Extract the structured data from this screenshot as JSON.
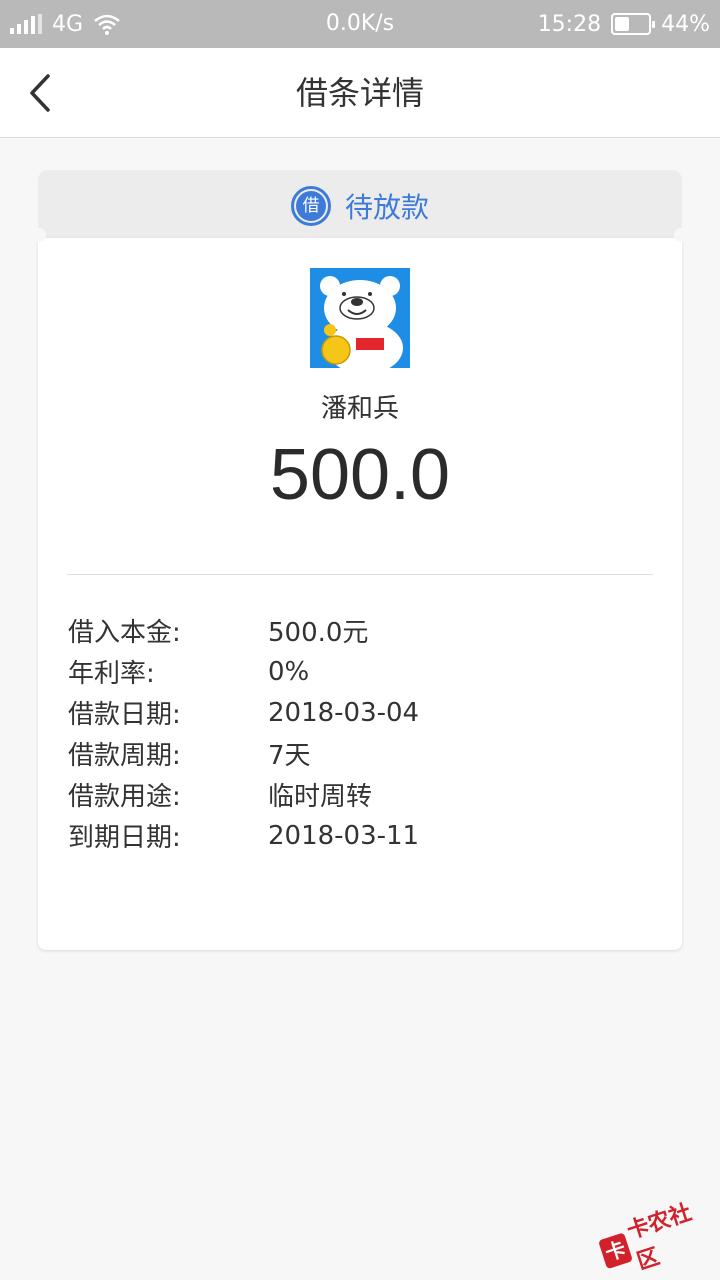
{
  "status_bar": {
    "network": "4G",
    "speed": "0.0K/s",
    "time": "15:28",
    "battery": "44%",
    "battery_level": 0.44
  },
  "header": {
    "title": "借条详情"
  },
  "status_tab": {
    "badge": "借",
    "text": "待放款",
    "color": "#3e7bd8"
  },
  "borrower": {
    "name": "潘和兵",
    "amount": "500.0"
  },
  "details": [
    {
      "label": "借入本金:",
      "value": "500.0元"
    },
    {
      "label": "年利率:",
      "value": "0%"
    },
    {
      "label": "借款日期:",
      "value": "2018-03-04"
    },
    {
      "label": "借款周期:",
      "value": "7天"
    },
    {
      "label": "借款用途:",
      "value": "临时周转"
    },
    {
      "label": "到期日期:",
      "value": "2018-03-11"
    }
  ],
  "watermark": {
    "text": "卡农社区",
    "icon": "卡"
  }
}
